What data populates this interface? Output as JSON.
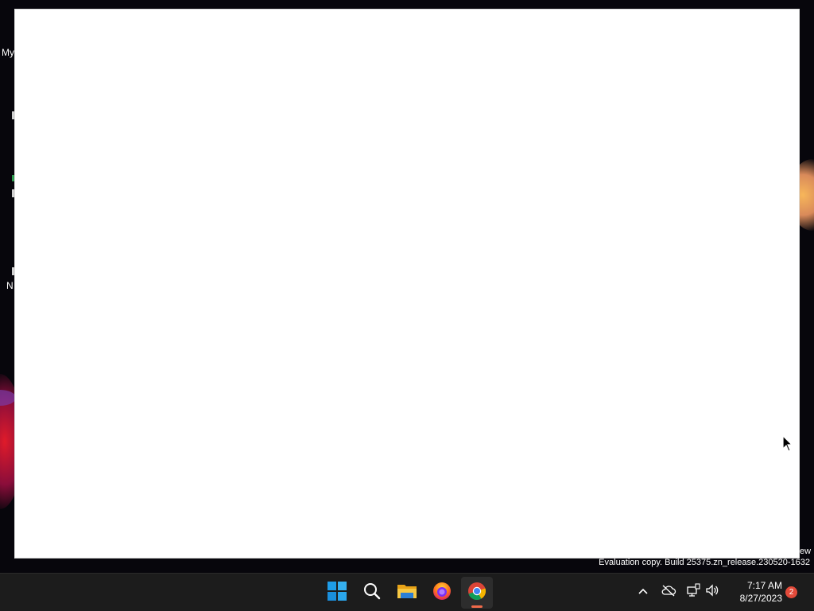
{
  "desktop": {
    "icons": [
      {
        "label": "My"
      },
      {
        "label": "N"
      }
    ],
    "partial_window_text": "ew",
    "watermark": "Evaluation copy. Build 25375.zn_release.230520-1632"
  },
  "taskbar": {
    "apps": [
      {
        "icon": "windows-start-icon"
      },
      {
        "icon": "search-icon"
      },
      {
        "icon": "file-explorer-icon"
      },
      {
        "icon": "firefox-icon"
      },
      {
        "icon": "chrome-icon"
      }
    ],
    "tray": {
      "clock_time": "7:17 AM",
      "clock_date": "8/27/2023",
      "notification_count": "2"
    }
  },
  "colors": {
    "taskbar_bg": "#1c1c1c",
    "window_bg": "#ffffff",
    "active_indicator": "#f06a4a",
    "badge": "#e24a3a"
  }
}
